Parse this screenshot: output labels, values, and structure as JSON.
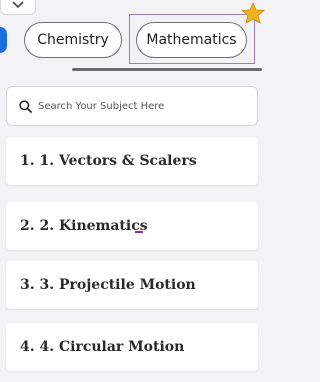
{
  "subject_tabs": [
    {
      "label": "Chemistry",
      "selected": false
    },
    {
      "label": "Mathematics",
      "selected": true
    }
  ],
  "search": {
    "placeholder": "Search Your Subject Here",
    "value": ""
  },
  "chapters": [
    {
      "label": "1. 1. Vectors & Scalers"
    },
    {
      "label": "2. 2. Kinematics"
    },
    {
      "label": "3. 3. Projectile Motion"
    },
    {
      "label": "4. 4. Circular Motion"
    }
  ],
  "colors": {
    "background": "#f3f3f5",
    "chip_border": "#6f6f73",
    "selection_frame": "#9a7fc7",
    "active_indicator": "#1a6fe0",
    "star": "#f2b01e"
  },
  "icons": {
    "collapse": "chevron-down-icon",
    "favorite": "star-icon",
    "search": "search-icon"
  }
}
